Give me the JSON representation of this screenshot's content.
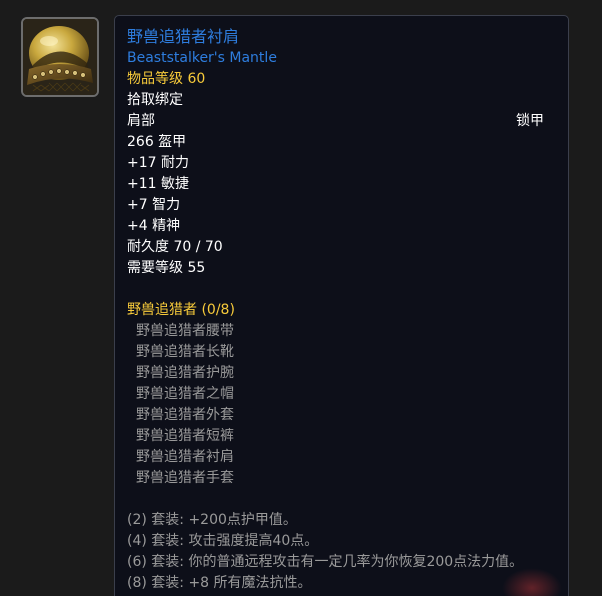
{
  "item": {
    "name_cn": "野兽追猎者衬肩",
    "name_en": "Beaststalker's Mantle",
    "item_level": "物品等级 60",
    "bind": "拾取绑定",
    "slot": "肩部",
    "armor_type": "锁甲",
    "armor": "266 盔甲",
    "stats": [
      "+17 耐力",
      "+11 敏捷",
      "+7 智力",
      "+4 精神"
    ],
    "durability": "耐久度 70 / 70",
    "required_level": "需要等级 55"
  },
  "set": {
    "title": "野兽追猎者 (0/8)",
    "pieces": [
      "野兽追猎者腰带",
      "野兽追猎者长靴",
      "野兽追猎者护腕",
      "野兽追猎者之帽",
      "野兽追猎者外套",
      "野兽追猎者短裤",
      "野兽追猎者衬肩",
      "野兽追猎者手套"
    ],
    "bonuses": [
      "(2) 套装: +200点护甲值。",
      "(4) 套装: 攻击强度提高40点。",
      "(6) 套装: 你的普通远程攻击有一定几率为你恢复200点法力值。",
      "(8) 套装: +8 所有魔法抗性。"
    ]
  },
  "icon": {
    "name": "shoulder-armor-icon"
  },
  "colors": {
    "title": "#2e7dde",
    "item_level": "#f8cb3a",
    "set_title": "#f8cb3a",
    "inactive": "#9a9a9a",
    "text": "#ffffff",
    "tooltip_bg": "#0d0f19",
    "page_bg": "#1b1b1b"
  }
}
